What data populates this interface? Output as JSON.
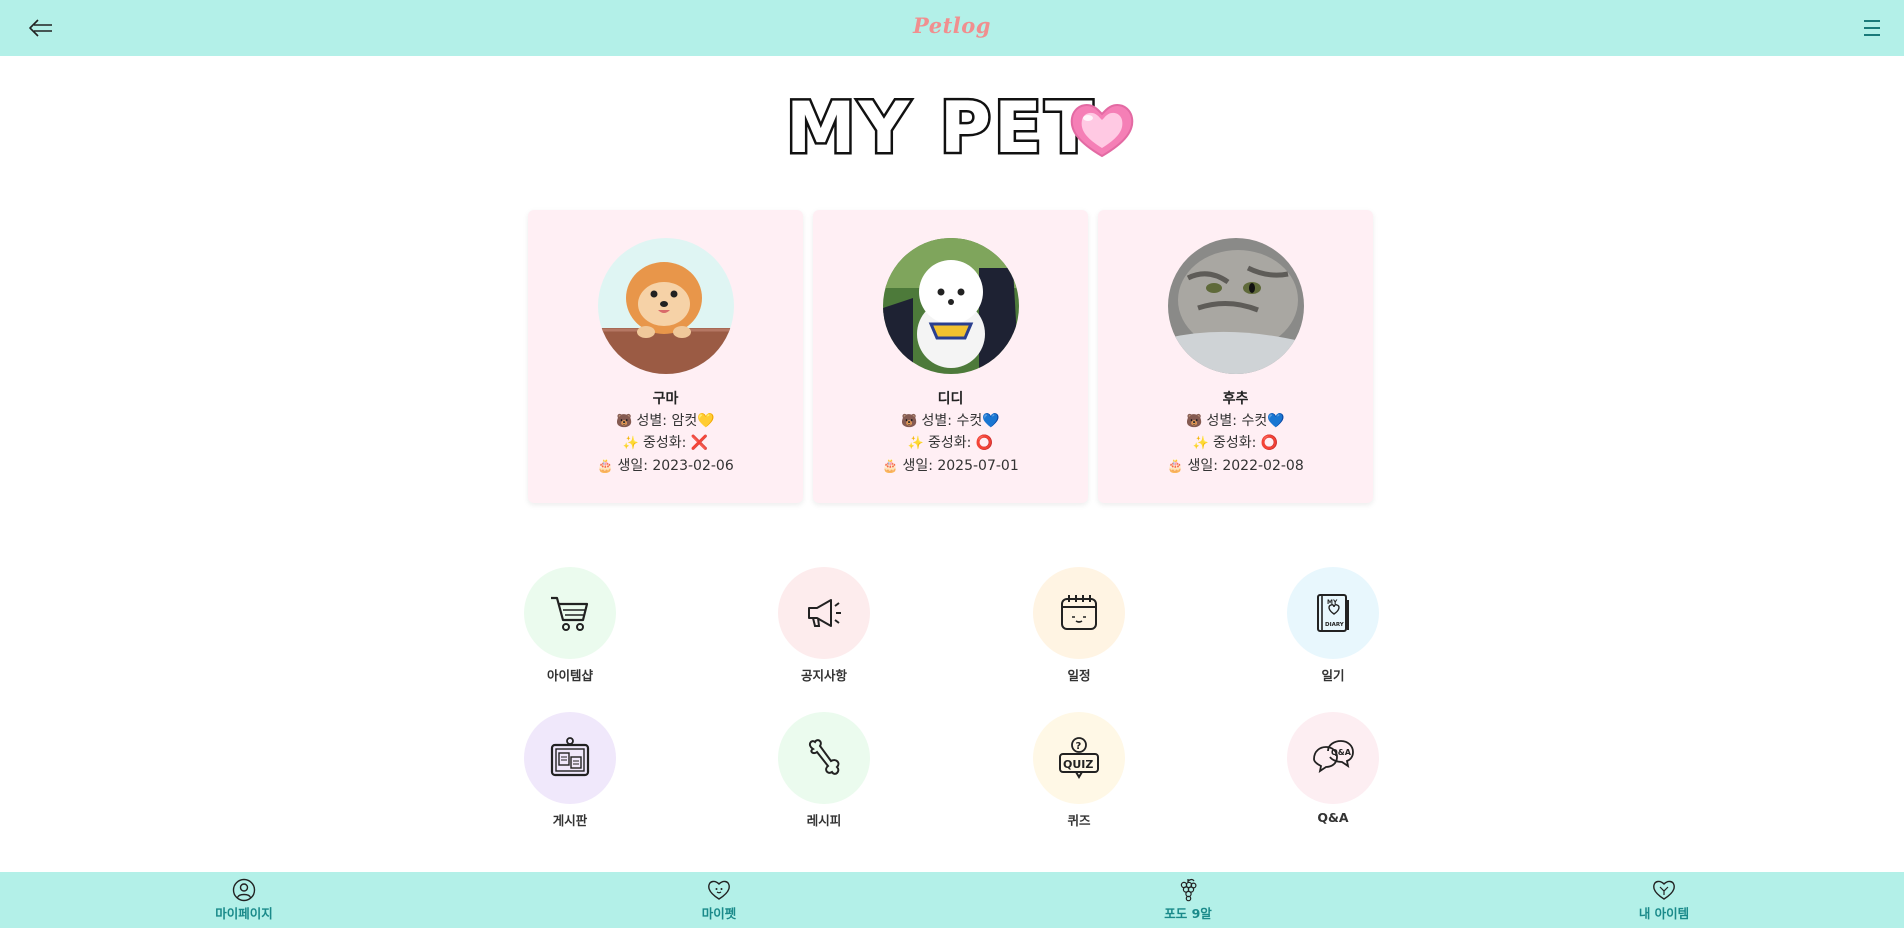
{
  "header": {
    "brand": "Petlog"
  },
  "hero": {
    "title": "MY PET"
  },
  "pets": [
    {
      "name": "구마",
      "gender_label": "성별: 암컷",
      "gender_emoji": "💛",
      "neuter_label": "중성화:",
      "neuter_emoji": "❌",
      "birthday_label": "생일: 2023-02-06"
    },
    {
      "name": "디디",
      "gender_label": "성별: 수컷",
      "gender_emoji": "💙",
      "neuter_label": "중성화:",
      "neuter_emoji": "⭕",
      "birthday_label": "생일: 2025-07-01"
    },
    {
      "name": "후추",
      "gender_label": "성별: 수컷",
      "gender_emoji": "💙",
      "neuter_label": "중성화:",
      "neuter_emoji": "⭕",
      "birthday_label": "생일: 2022-02-08"
    }
  ],
  "pet_icons": {
    "gender": "🐻",
    "neuter": "✨",
    "birthday": "🎂"
  },
  "menu": [
    {
      "label": "아이템샵",
      "icon": "cart-icon",
      "color": "#ebfbee"
    },
    {
      "label": "공지사항",
      "icon": "megaphone-icon",
      "color": "#fdeced"
    },
    {
      "label": "일정",
      "icon": "calendar-icon",
      "color": "#fff4e3"
    },
    {
      "label": "일기",
      "icon": "diary-icon",
      "color": "#e8f7fd"
    },
    {
      "label": "게시판",
      "icon": "board-icon",
      "color": "#f0e8fb"
    },
    {
      "label": "레시피",
      "icon": "bone-icon",
      "color": "#ebfbee"
    },
    {
      "label": "퀴즈",
      "icon": "quiz-icon",
      "color": "#fff8e6"
    },
    {
      "label": "Q&A",
      "icon": "qa-icon",
      "color": "#fdeef2"
    }
  ],
  "bottom_nav": [
    {
      "label": "마이페이지",
      "icon": "user-icon"
    },
    {
      "label": "마이펫",
      "icon": "pet-heart-icon"
    },
    {
      "label": "포도 9알",
      "icon": "grape-icon"
    },
    {
      "label": "내 아이템",
      "icon": "item-heart-icon"
    }
  ],
  "colors": {
    "bar": "#b3f0e8",
    "brand": "#f08f8f",
    "card": "#ffeff4",
    "tab_text": "#1a8a8a"
  }
}
